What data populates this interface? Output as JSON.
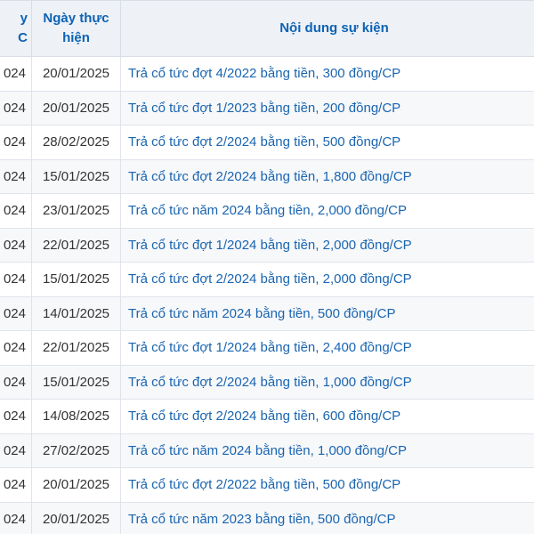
{
  "header": {
    "col_a": "y\nC",
    "col_b": "Ngày thực\nhiện",
    "col_c": "Nội dung sự kiện"
  },
  "rows": [
    {
      "a": "024",
      "date": "20/01/2025",
      "event": "Trả cổ tức đợt 4/2022 bằng tiền, 300 đồng/CP"
    },
    {
      "a": "024",
      "date": "20/01/2025",
      "event": "Trả cổ tức đợt 1/2023 bằng tiền, 200 đồng/CP"
    },
    {
      "a": "024",
      "date": "28/02/2025",
      "event": "Trả cổ tức đợt 2/2024 bằng tiền, 500 đồng/CP"
    },
    {
      "a": "024",
      "date": "15/01/2025",
      "event": "Trả cổ tức đợt 2/2024 bằng tiền, 1,800 đồng/CP"
    },
    {
      "a": "024",
      "date": "23/01/2025",
      "event": "Trả cổ tức năm 2024 bằng tiền, 2,000 đồng/CP"
    },
    {
      "a": "024",
      "date": "22/01/2025",
      "event": "Trả cổ tức đợt 1/2024 bằng tiền, 2,000 đồng/CP"
    },
    {
      "a": "024",
      "date": "15/01/2025",
      "event": "Trả cổ tức đợt 2/2024 bằng tiền, 2,000 đồng/CP"
    },
    {
      "a": "024",
      "date": "14/01/2025",
      "event": "Trả cổ tức năm 2024 bằng tiền, 500 đồng/CP"
    },
    {
      "a": "024",
      "date": "22/01/2025",
      "event": "Trả cổ tức đợt 1/2024 bằng tiền, 2,400 đồng/CP"
    },
    {
      "a": "024",
      "date": "15/01/2025",
      "event": "Trả cổ tức đợt 2/2024 bằng tiền, 1,000 đồng/CP"
    },
    {
      "a": "024",
      "date": "14/08/2025",
      "event": "Trả cổ tức đợt 2/2024 bằng tiền, 600 đồng/CP"
    },
    {
      "a": "024",
      "date": "27/02/2025",
      "event": "Trả cổ tức năm 2024 bằng tiền, 1,000 đồng/CP"
    },
    {
      "a": "024",
      "date": "20/01/2025",
      "event": "Trả cổ tức đợt 2/2022 bằng tiền, 500 đồng/CP"
    },
    {
      "a": "024",
      "date": "20/01/2025",
      "event": "Trả cổ tức năm 2023 bằng tiền, 500 đồng/CP"
    }
  ]
}
